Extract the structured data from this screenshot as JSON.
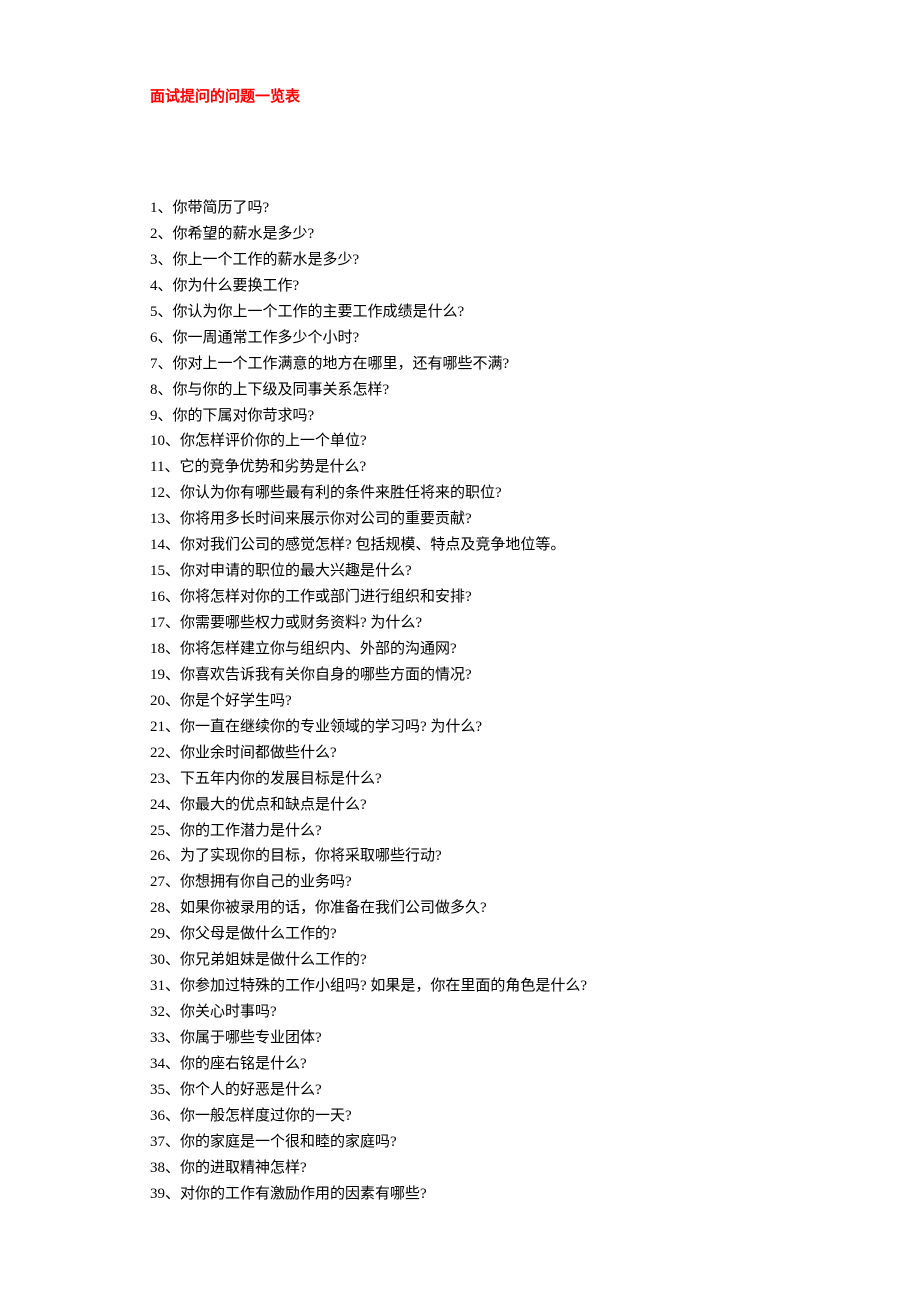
{
  "title": "面试提问的问题一览表",
  "questions": [
    "1、你带简历了吗?",
    "2、你希望的薪水是多少?",
    "3、你上一个工作的薪水是多少?",
    "4、你为什么要换工作?",
    "5、你认为你上一个工作的主要工作成绩是什么?",
    "6、你一周通常工作多少个小时?",
    "7、你对上一个工作满意的地方在哪里，还有哪些不满?",
    "8、你与你的上下级及同事关系怎样?",
    "9、你的下属对你苛求吗?",
    "10、你怎样评价你的上一个单位?",
    "11、它的竞争优势和劣势是什么?",
    "12、你认为你有哪些最有利的条件来胜任将来的职位?",
    "13、你将用多长时间来展示你对公司的重要贡献?",
    "14、你对我们公司的感觉怎样? 包括规模、特点及竞争地位等。",
    "15、你对申请的职位的最大兴趣是什么?",
    "16、你将怎样对你的工作或部门进行组织和安排?",
    "17、你需要哪些权力或财务资料? 为什么?",
    "18、你将怎样建立你与组织内、外部的沟通网?",
    "19、你喜欢告诉我有关你自身的哪些方面的情况?",
    "20、你是个好学生吗?",
    "21、你一直在继续你的专业领域的学习吗? 为什么?",
    "22、你业余时间都做些什么?",
    "23、下五年内你的发展目标是什么?",
    "24、你最大的优点和缺点是什么?",
    "25、你的工作潜力是什么?",
    "26、为了实现你的目标，你将采取哪些行动?",
    "27、你想拥有你自己的业务吗?",
    "28、如果你被录用的话，你准备在我们公司做多久?",
    "29、你父母是做什么工作的?",
    "30、你兄弟姐妹是做什么工作的?",
    "31、你参加过特殊的工作小组吗? 如果是，你在里面的角色是什么?",
    "32、你关心时事吗?",
    "33、你属于哪些专业团体?",
    "34、你的座右铭是什么?",
    "35、你个人的好恶是什么?",
    "36、你一般怎样度过你的一天?",
    "37、你的家庭是一个很和睦的家庭吗?",
    "38、你的进取精神怎样?",
    "39、对你的工作有激励作用的因素有哪些?"
  ]
}
